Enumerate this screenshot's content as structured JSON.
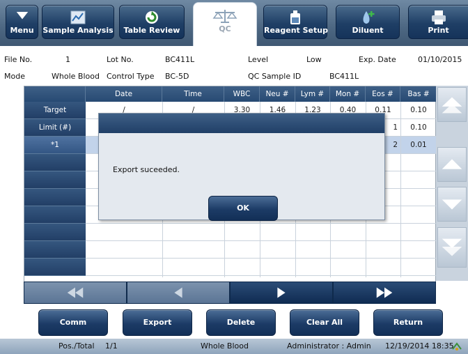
{
  "toolbar": {
    "menu": "Menu",
    "sample_analysis": "Sample Analysis",
    "table_review": "Table Review",
    "qc": "QC",
    "reagent_setup": "Reagent Setup",
    "diluent": "Diluent",
    "print": "Print"
  },
  "info": {
    "file_no_label": "File No.",
    "file_no": "1",
    "lot_no_label": "Lot No.",
    "lot_no": "BC411L",
    "level_label": "Level",
    "level": "Low",
    "exp_date_label": "Exp. Date",
    "exp_date": "01/10/2015",
    "mode_label": "Mode",
    "mode": "Whole Blood",
    "control_type_label": "Control Type",
    "control_type": "BC-5D",
    "qc_sample_id_label": "QC Sample ID",
    "qc_sample_id": "BC411L"
  },
  "table": {
    "headers": [
      "Date",
      "Time",
      "WBC",
      "Neu #",
      "Lym #",
      "Mon #",
      "Eos #",
      "Bas #"
    ],
    "row_labels": [
      "Target",
      "Limit (#)",
      "*1"
    ],
    "visible_cells": {
      "target_date": "/",
      "target_time": "/",
      "target_wbc": "3.30",
      "target_neu": "1.46",
      "target_lym": "1.23",
      "target_mon": "0.40",
      "target_eos": "0.11",
      "target_bas": "0.10",
      "limit_eos": "1",
      "limit_bas": "0.10",
      "r1_eos": "2",
      "r1_bas": "0.01"
    }
  },
  "dialog": {
    "message": "Export suceeded.",
    "ok": "OK"
  },
  "actions": {
    "comm": "Comm",
    "export": "Export",
    "delete": "Delete",
    "clear_all": "Clear All",
    "return": "Return"
  },
  "status": {
    "pos_total_label": "Pos./Total",
    "pos_total": "1/1",
    "mode": "Whole Blood",
    "user": "Administrator : Admin",
    "datetime": "12/19/2014 18:35"
  },
  "colors": {
    "toolbar": "#4d6782",
    "header": "#2d4f78",
    "button": "#1c3b66",
    "status": "#a3b6c9"
  }
}
